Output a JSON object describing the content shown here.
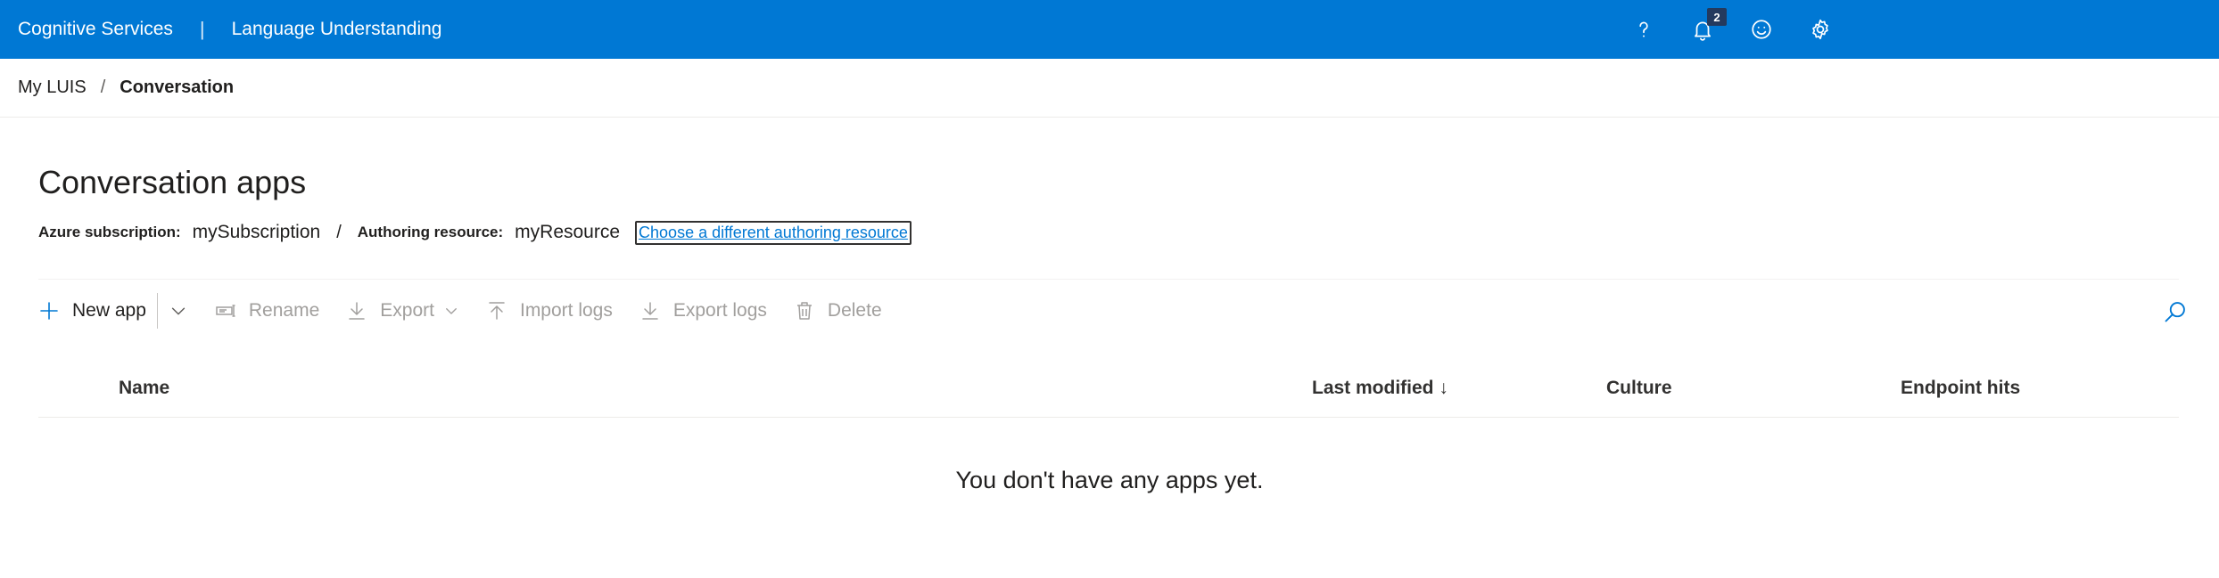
{
  "header": {
    "product": "Cognitive Services",
    "separator": "|",
    "app_name": "Language Understanding",
    "notification_count": "2",
    "icons": [
      "help-icon",
      "bell-icon",
      "smiley-icon",
      "gear-icon"
    ]
  },
  "breadcrumb": {
    "root": "My LUIS",
    "separator": "/",
    "current": "Conversation"
  },
  "page": {
    "title": "Conversation apps",
    "subscription_label": "Azure subscription:",
    "subscription_value": "mySubscription",
    "slash": "/",
    "resource_label": "Authoring resource:",
    "resource_value": "myResource",
    "change_resource_link": "Choose a different authoring resource"
  },
  "toolbar": {
    "new_app": "New app",
    "rename": "Rename",
    "export": "Export",
    "import_logs": "Import logs",
    "export_logs": "Export logs",
    "delete": "Delete"
  },
  "table": {
    "columns": [
      "Name",
      "Last modified ↓",
      "Culture",
      "Endpoint hits"
    ],
    "empty_message": "You don't have any apps yet."
  },
  "colors": {
    "accent": "#0078d4",
    "disabled_text": "#a19f9d"
  }
}
